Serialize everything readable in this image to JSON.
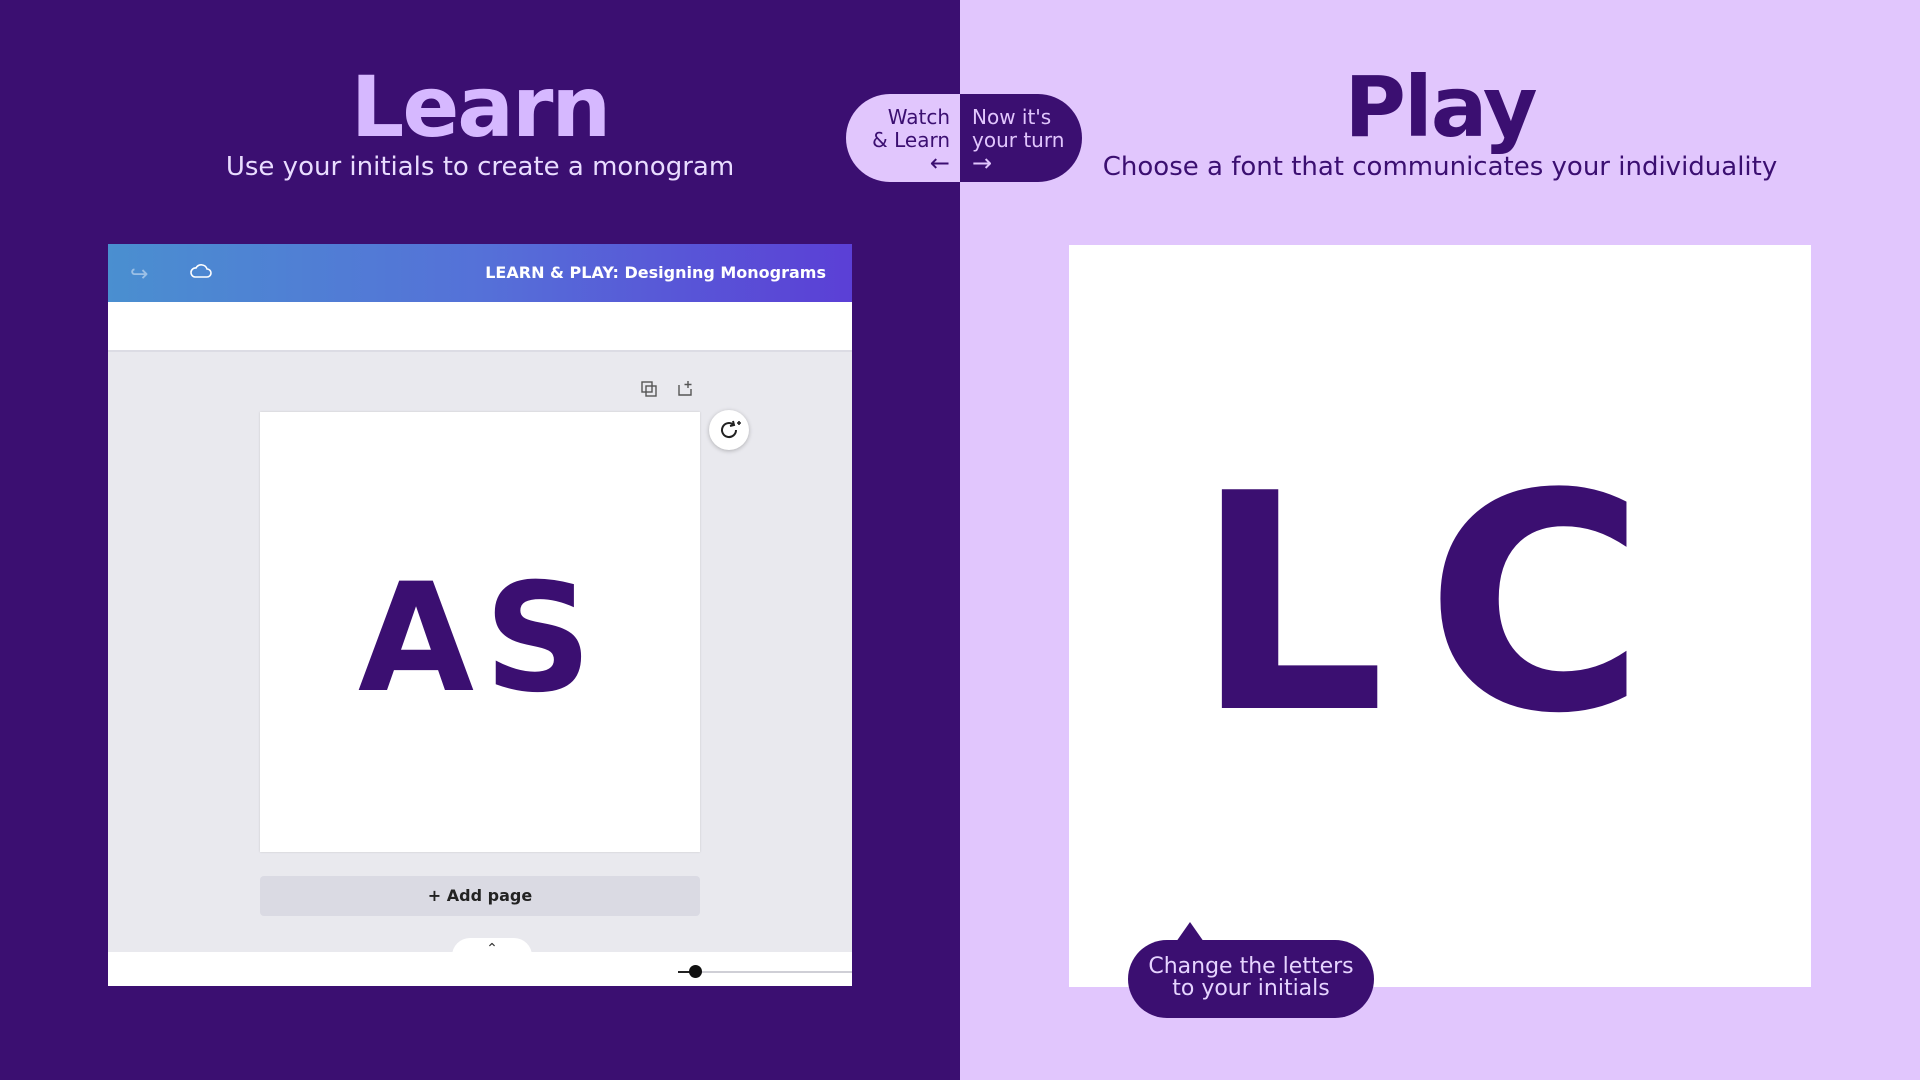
{
  "learn": {
    "title": "Learn",
    "subtitle": "Use your initials to create a monogram"
  },
  "play": {
    "title": "Play",
    "subtitle": "Choose a font that communicates your individuality"
  },
  "toggle": {
    "left_line1": "Watch",
    "left_line2": "& Learn",
    "left_arrow": "←",
    "right_line1": "Now it's",
    "right_line2": "your turn",
    "right_arrow": "→"
  },
  "editor": {
    "title": "LEARN & PLAY: Designing Monograms",
    "monogram": "AS",
    "add_page_label": "+ Add page",
    "footer_tab": "⌃",
    "zoom_level": 0.1
  },
  "play_canvas": {
    "monogram": "LC",
    "tooltip_line1": "Change the letters",
    "tooltip_line2": "to your initials"
  },
  "colors": {
    "dark_purple": "#3b0f71",
    "light_purple": "#e1c6fd"
  }
}
